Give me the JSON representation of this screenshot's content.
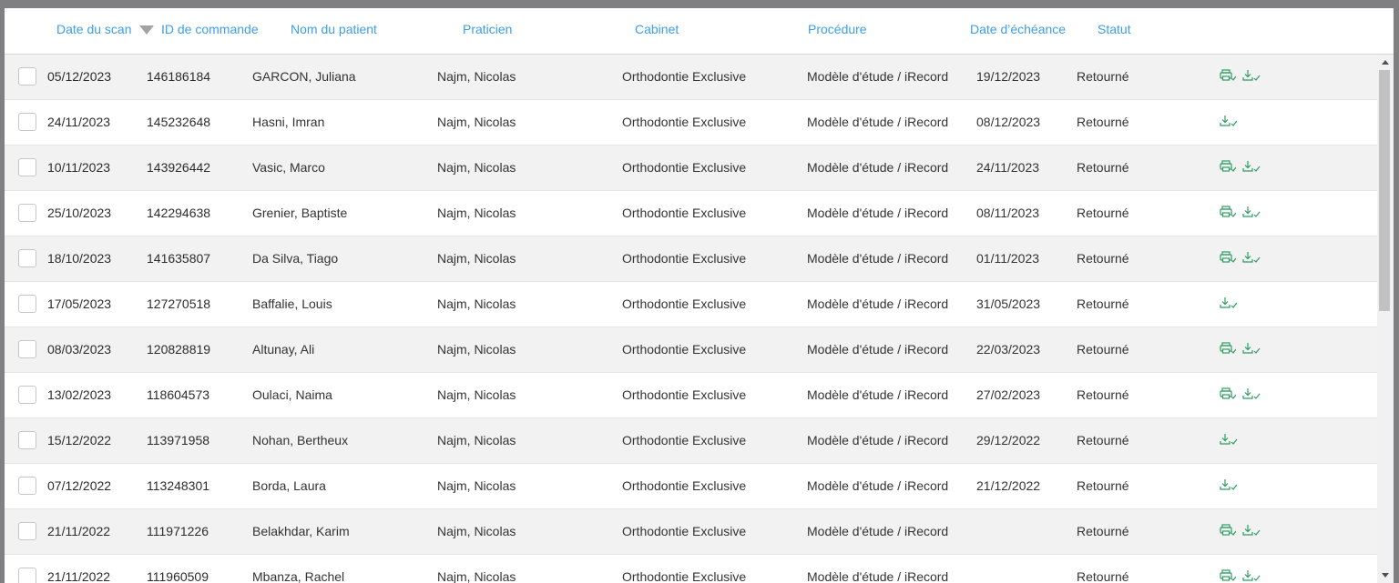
{
  "columns": {
    "scan_date": "Date du scan",
    "order_id": "ID de commande",
    "patient": "Nom du patient",
    "practitioner": "Praticien",
    "office": "Cabinet",
    "procedure": "Procédure",
    "due_date": "Date d’échéance",
    "status": "Statut"
  },
  "sort": {
    "column": "scan_date",
    "direction": "descending",
    "icon": "sort-down-icon"
  },
  "colors": {
    "accent": "#3d9ee6",
    "action_icon": "#2e9d61",
    "row_alt": "#f2f2f2"
  },
  "rows": [
    {
      "scan_date": "05/12/2023",
      "order_id": "146186184",
      "patient": "GARCON, Juliana",
      "practitioner": "Najm, Nicolas",
      "office": "Orthodontie Exclusive",
      "procedure": "Modèle d'étude / iRecord",
      "due_date": "19/12/2023",
      "status": "Retourné",
      "icons": [
        "print-check-icon",
        "download-check-icon"
      ]
    },
    {
      "scan_date": "24/11/2023",
      "order_id": "145232648",
      "patient": "Hasni, Imran",
      "practitioner": "Najm, Nicolas",
      "office": "Orthodontie Exclusive",
      "procedure": "Modèle d'étude / iRecord",
      "due_date": "08/12/2023",
      "status": "Retourné",
      "icons": [
        "download-check-icon"
      ]
    },
    {
      "scan_date": "10/11/2023",
      "order_id": "143926442",
      "patient": "Vasic, Marco",
      "practitioner": "Najm, Nicolas",
      "office": "Orthodontie Exclusive",
      "procedure": "Modèle d'étude / iRecord",
      "due_date": "24/11/2023",
      "status": "Retourné",
      "icons": [
        "print-check-icon",
        "download-check-icon"
      ]
    },
    {
      "scan_date": "25/10/2023",
      "order_id": "142294638",
      "patient": "Grenier, Baptiste",
      "practitioner": "Najm, Nicolas",
      "office": "Orthodontie Exclusive",
      "procedure": "Modèle d'étude / iRecord",
      "due_date": "08/11/2023",
      "status": "Retourné",
      "icons": [
        "print-check-icon",
        "download-check-icon"
      ]
    },
    {
      "scan_date": "18/10/2023",
      "order_id": "141635807",
      "patient": "Da Silva, Tiago",
      "practitioner": "Najm, Nicolas",
      "office": "Orthodontie Exclusive",
      "procedure": "Modèle d'étude / iRecord",
      "due_date": "01/11/2023",
      "status": "Retourné",
      "icons": [
        "print-check-icon",
        "download-check-icon"
      ]
    },
    {
      "scan_date": "17/05/2023",
      "order_id": "127270518",
      "patient": "Baffalie, Louis",
      "practitioner": "Najm, Nicolas",
      "office": "Orthodontie Exclusive",
      "procedure": "Modèle d'étude / iRecord",
      "due_date": "31/05/2023",
      "status": "Retourné",
      "icons": [
        "download-check-icon"
      ]
    },
    {
      "scan_date": "08/03/2023",
      "order_id": "120828819",
      "patient": "Altunay, Ali",
      "practitioner": "Najm, Nicolas",
      "office": "Orthodontie Exclusive",
      "procedure": "Modèle d'étude / iRecord",
      "due_date": "22/03/2023",
      "status": "Retourné",
      "icons": [
        "print-check-icon",
        "download-check-icon"
      ]
    },
    {
      "scan_date": "13/02/2023",
      "order_id": "118604573",
      "patient": "Oulaci, Naima",
      "practitioner": "Najm, Nicolas",
      "office": "Orthodontie Exclusive",
      "procedure": "Modèle d'étude / iRecord",
      "due_date": "27/02/2023",
      "status": "Retourné",
      "icons": [
        "print-check-icon",
        "download-check-icon"
      ]
    },
    {
      "scan_date": "15/12/2022",
      "order_id": "113971958",
      "patient": "Nohan, Bertheux",
      "practitioner": "Najm, Nicolas",
      "office": "Orthodontie Exclusive",
      "procedure": "Modèle d'étude / iRecord",
      "due_date": "29/12/2022",
      "status": "Retourné",
      "icons": [
        "download-check-icon"
      ]
    },
    {
      "scan_date": "07/12/2022",
      "order_id": "113248301",
      "patient": "Borda, Laura",
      "practitioner": "Najm, Nicolas",
      "office": "Orthodontie Exclusive",
      "procedure": "Modèle d'étude / iRecord",
      "due_date": "21/12/2022",
      "status": "Retourné",
      "icons": [
        "download-check-icon"
      ]
    },
    {
      "scan_date": "21/11/2022",
      "order_id": "111971226",
      "patient": "Belakhdar, Karim",
      "practitioner": "Najm, Nicolas",
      "office": "Orthodontie Exclusive",
      "procedure": "Modèle d'étude / iRecord",
      "due_date": "",
      "status": "Retourné",
      "icons": [
        "print-check-icon",
        "download-check-icon"
      ]
    },
    {
      "scan_date": "21/11/2022",
      "order_id": "111960509",
      "patient": "Mbanza, Rachel",
      "practitioner": "Najm, Nicolas",
      "office": "Orthodontie Exclusive",
      "procedure": "Modèle d'étude / iRecord",
      "due_date": "",
      "status": "Retourné",
      "icons": [
        "print-check-icon",
        "download-check-icon"
      ]
    }
  ]
}
